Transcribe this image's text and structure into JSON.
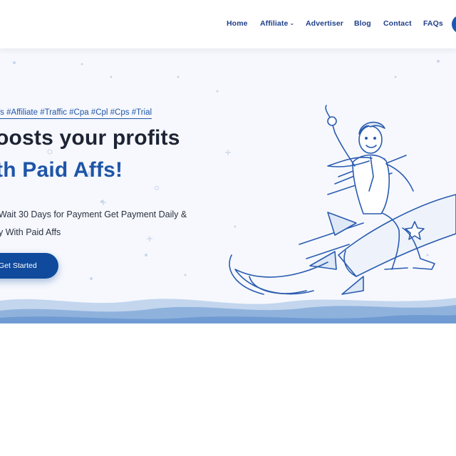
{
  "nav": {
    "items": [
      {
        "label": "Home"
      },
      {
        "label": "Affiliate",
        "has_dropdown": true
      },
      {
        "label": "Advertiser"
      },
      {
        "label": "Blog"
      },
      {
        "label": "Contact"
      },
      {
        "label": "FAQs"
      }
    ]
  },
  "hero": {
    "tags": "ffs #Affiliate #Traffic #Cpa #Cpl #Cps #Trial",
    "headline_line1": "oosts your profits",
    "headline_line2": "th Paid Affs!",
    "subtext_line1": "Wait 30 Days for Payment Get Payment Daily &",
    "subtext_line2": "y With Paid Affs",
    "cta_label": "Get Started",
    "illustration": "businessman-riding-rocket-sketch"
  },
  "colors": {
    "nav_text": "#1e3f8a",
    "accent_blue": "#1f55a8",
    "button_bg": "#0f4a9c",
    "headline_dark": "#1d2433",
    "hero_bg": "#f6f8fd",
    "wave_light": "#c3d6ee",
    "wave_mid": "#8fb2dd"
  }
}
